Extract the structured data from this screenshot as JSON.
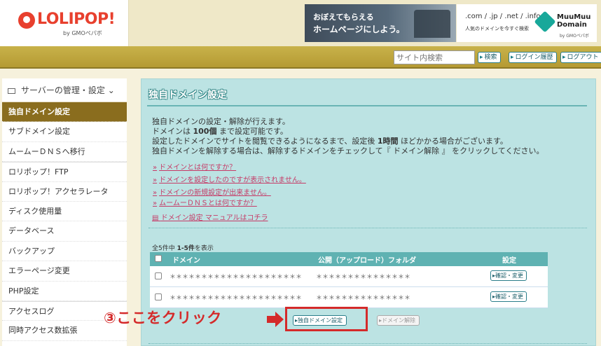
{
  "header": {
    "logo_text": "LOLIPOP!",
    "logo_sub": "by GMOペパボ",
    "ad1_line1": "おぼえてもらえる",
    "ad1_line2": "ホームページにしよう。",
    "ad2_line1": ".com / .jp / .net / .info",
    "ad2_line2": "人気のドメインを今すぐ検索",
    "ad2_brand_1": "MuuMuu",
    "ad2_brand_2": "Domain",
    "ad2_brand_sub": "by GMOペパボ"
  },
  "navbar": {
    "search_placeholder": "サイト内検索",
    "search_button": "検索",
    "login_history_button": "ログイン履歴",
    "logout_button": "ログアウト"
  },
  "sidebar": {
    "header": "サーバーの管理・設定",
    "items": [
      {
        "label": "独自ドメイン設定"
      },
      {
        "label": "サブドメイン設定"
      },
      {
        "label": "ムームーＤＮＳへ移行"
      },
      {
        "label": "ロリポップ！FTP"
      },
      {
        "label": "ロリポップ！アクセラレータ"
      },
      {
        "label": "ディスク使用量"
      },
      {
        "label": "データベース"
      },
      {
        "label": "バックアップ"
      },
      {
        "label": "エラーページ変更"
      },
      {
        "label": "PHP設定"
      },
      {
        "label": "アクセスログ"
      },
      {
        "label": "同時アクセス数拡張"
      }
    ]
  },
  "main": {
    "title": "独自ドメイン設定",
    "desc_line1": "独自ドメインの設定・解除が行えます。",
    "desc_line2_pre": "ドメインは ",
    "desc_line2_bold": "100個",
    "desc_line2_post": " まで設定可能です。",
    "desc_line3_pre": "設定したドメインでサイトを閲覧できるようになるまで、設定後 ",
    "desc_line3_bold": "1時間",
    "desc_line3_post": " ほどかかる場合がございます。",
    "desc_line4": "独自ドメインを解除する場合は、解除するドメインをチェックして『 ドメイン解除 』 をクリックしてください。",
    "faq": [
      "ドメインとは何ですか？",
      "ドメインを設定したのですが表示されません。",
      "ドメインの新規設定が出来ません。",
      "ムームーＤＮＳとは何ですか？"
    ],
    "manual_link": "ドメイン設定 マニュアルはコチラ",
    "count_pre": "全5件中 ",
    "count_bold": "1-5件",
    "count_post": "を表示",
    "table_headers": {
      "domain": "ドメイン",
      "folder": "公開（アップロード）フォルダ",
      "setting": "設定"
    },
    "rows": [
      {
        "domain": "＊＊＊＊＊＊＊＊＊＊＊＊＊＊＊＊＊＊＊＊＊",
        "folder": "＊＊＊＊＊＊＊＊＊＊＊＊＊＊＊",
        "action": "確認・変更"
      },
      {
        "domain": "＊＊＊＊＊＊＊＊＊＊＊＊＊＊＊＊＊＊＊＊＊",
        "folder": "＊＊＊＊＊＊＊＊＊＊＊＊＊＊＊",
        "action": "確認・変更"
      }
    ],
    "add_domain_button": "独自ドメイン設定",
    "remove_domain_button": "ドメイン解除"
  },
  "annotation": {
    "text": "③ここをクリック",
    "color": "#d42a2a"
  }
}
